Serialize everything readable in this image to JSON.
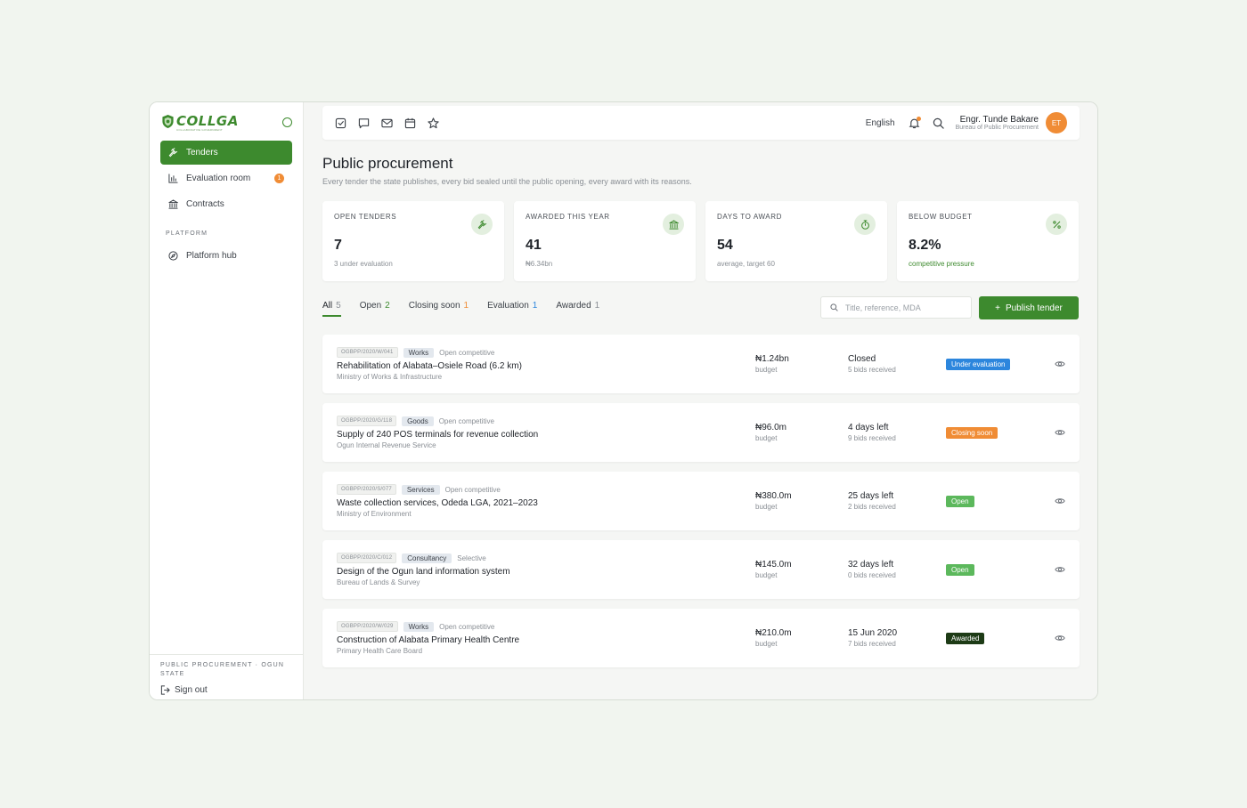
{
  "brand": {
    "name": "COLLGA",
    "tagline": "COLLABORATIVE GOVERNMENT"
  },
  "sidebar": {
    "items": [
      {
        "label": "Tenders",
        "icon": "gavel-icon",
        "active": true
      },
      {
        "label": "Evaluation room",
        "icon": "chart-icon",
        "badge": "1"
      },
      {
        "label": "Contracts",
        "icon": "bank-icon"
      }
    ],
    "section": "PLATFORM",
    "platform_items": [
      {
        "label": "Platform hub",
        "icon": "compass-icon"
      }
    ],
    "footer_org": "PUBLIC PROCUREMENT · OGUN STATE",
    "signout": "Sign out"
  },
  "topbar": {
    "icons": [
      "checkbox-icon",
      "chat-icon",
      "mail-icon",
      "calendar-icon",
      "star-icon"
    ],
    "language": "English",
    "user": {
      "name": "Engr. Tunde Bakare",
      "role": "Bureau of Public Procurement",
      "initials": "ET"
    }
  },
  "page": {
    "title": "Public procurement",
    "subtitle": "Every tender the state publishes, every bid sealed until the public opening, every award with its reasons."
  },
  "kpis": [
    {
      "label": "OPEN TENDERS",
      "value": "7",
      "sub": "3 under evaluation",
      "icon": "gavel-icon"
    },
    {
      "label": "AWARDED THIS YEAR",
      "value": "41",
      "sub": "₦6.34bn",
      "icon": "bank-icon"
    },
    {
      "label": "DAYS TO AWARD",
      "value": "54",
      "sub": "average, target 60",
      "icon": "stopwatch-icon"
    },
    {
      "label": "BELOW BUDGET",
      "value": "8.2%",
      "sub": "competitive pressure",
      "icon": "percent-icon"
    }
  ],
  "tabs": [
    {
      "label": "All",
      "count": "5",
      "color": "#8a8f95"
    },
    {
      "label": "Open",
      "count": "2",
      "color": "#3d8a2e"
    },
    {
      "label": "Closing soon",
      "count": "1",
      "color": "#f08c35"
    },
    {
      "label": "Evaluation",
      "count": "1",
      "color": "#2c86dd"
    },
    {
      "label": "Awarded",
      "count": "1",
      "color": "#8a8f95"
    }
  ],
  "search": {
    "placeholder": "Title, reference, MDA",
    "value": ""
  },
  "publish_button": "Publish tender",
  "tenders": [
    {
      "ref": "OGBPP/2020/W/041",
      "category": "Works",
      "procedure": "Open competitive",
      "title": "Rehabilitation of Alabata–Osiele Road (6.2 km)",
      "mda": "Ministry of Works & Infrastructure",
      "budget": "₦1.24bn",
      "budget_label": "budget",
      "deadline": "Closed",
      "bids": "5 bids received",
      "status": "Under evaluation",
      "status_class": "st-eval"
    },
    {
      "ref": "OGBPP/2020/G/118",
      "category": "Goods",
      "procedure": "Open competitive",
      "title": "Supply of 240 POS terminals for revenue collection",
      "mda": "Ogun Internal Revenue Service",
      "budget": "₦96.0m",
      "budget_label": "budget",
      "deadline": "4 days left",
      "bids": "9 bids received",
      "status": "Closing soon",
      "status_class": "st-soon"
    },
    {
      "ref": "OGBPP/2020/S/077",
      "category": "Services",
      "procedure": "Open competitive",
      "title": "Waste collection services, Odeda LGA, 2021–2023",
      "mda": "Ministry of Environment",
      "budget": "₦380.0m",
      "budget_label": "budget",
      "deadline": "25 days left",
      "bids": "2 bids received",
      "status": "Open",
      "status_class": "st-open"
    },
    {
      "ref": "OGBPP/2020/C/012",
      "category": "Consultancy",
      "procedure": "Selective",
      "title": "Design of the Ogun land information system",
      "mda": "Bureau of Lands & Survey",
      "budget": "₦145.0m",
      "budget_label": "budget",
      "deadline": "32 days left",
      "bids": "0 bids received",
      "status": "Open",
      "status_class": "st-open"
    },
    {
      "ref": "OGBPP/2020/W/029",
      "category": "Works",
      "procedure": "Open competitive",
      "title": "Construction of Alabata Primary Health Centre",
      "mda": "Primary Health Care Board",
      "budget": "₦210.0m",
      "budget_label": "budget",
      "deadline": "15 Jun 2020",
      "bids": "7 bids received",
      "status": "Awarded",
      "status_class": "st-awarded"
    }
  ],
  "colors": {
    "accent": "#3d8a2e",
    "warning": "#f08c35",
    "info": "#2c86dd",
    "dark_green": "#1d3b16"
  }
}
